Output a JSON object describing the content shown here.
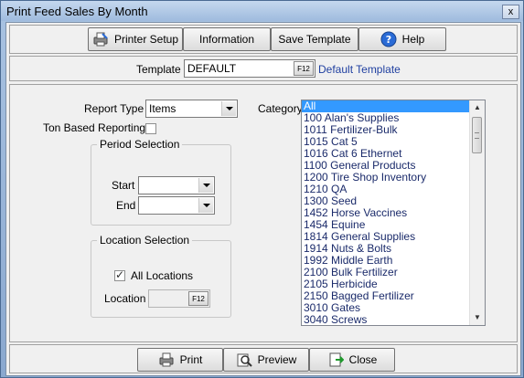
{
  "window": {
    "title": "Print Feed Sales By Month",
    "close_label": "x"
  },
  "toolbar": {
    "printer_setup": "Printer Setup",
    "information": "Information",
    "save_template": "Save Template",
    "help": "Help"
  },
  "template": {
    "label": "Template",
    "value": "DEFAULT",
    "lookup_key": "F12",
    "description": "Default Template"
  },
  "form": {
    "report_type_label": "Report Type",
    "report_type_value": "Items",
    "ton_based_label": "Ton Based Reporting",
    "ton_based_checked": false,
    "period_selection": {
      "legend": "Period Selection",
      "start_label": "Start",
      "end_label": "End",
      "start_value": "",
      "end_value": ""
    },
    "location_selection": {
      "legend": "Location Selection",
      "all_locations_label": "All Locations",
      "all_locations_checked": true,
      "location_label": "Location",
      "location_lookup_key": "F12"
    },
    "category_label": "Category"
  },
  "categories": [
    "All",
    "100 Alan's Supplies",
    "1011 Fertilizer-Bulk",
    "1015 Cat 5",
    "1016 Cat 6 Ethernet",
    "1100 General Products",
    "1200 Tire Shop Inventory",
    "1210 QA",
    "1300 Seed",
    "1452 Horse Vaccines",
    "1454 Equine",
    "1814 General Supplies",
    "1914 Nuts & Bolts",
    "1992 Middle Earth",
    "2100 Bulk Fertilizer",
    "2105 Herbicide",
    "2150 Bagged Fertilizer",
    "3010 Gates",
    "3040 Screws"
  ],
  "selected_category": "All",
  "footer": {
    "print": "Print",
    "preview": "Preview",
    "close": "Close"
  },
  "colors": {
    "title_bar": "#9fbbde",
    "selection": "#3399ff",
    "list_text": "#1a2a6a",
    "template_desc": "#1f3fa0"
  }
}
